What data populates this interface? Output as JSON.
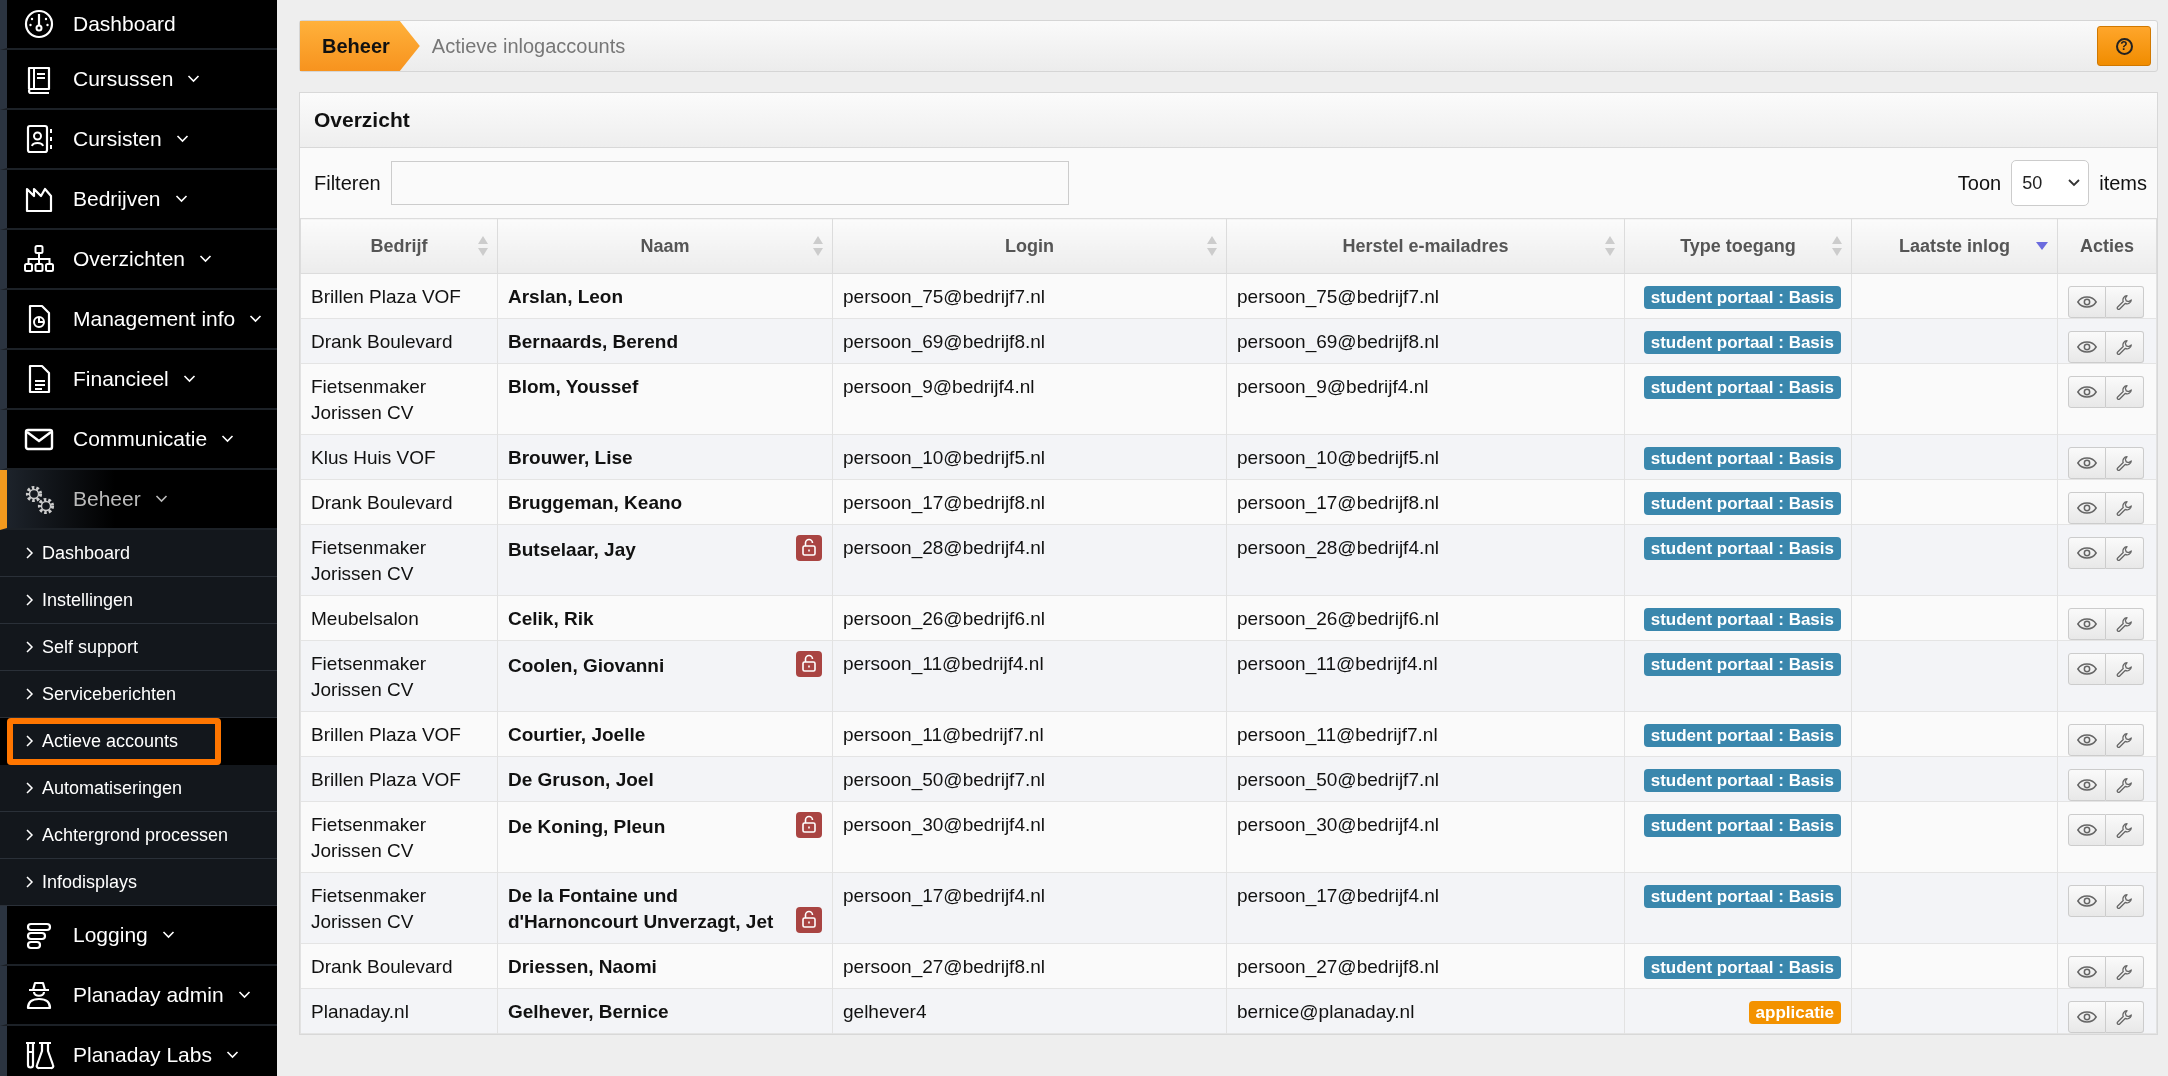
{
  "sidebar": {
    "items": [
      {
        "label": "Dashboard",
        "has_caret": false,
        "selected": false
      },
      {
        "label": "Cursussen",
        "has_caret": true,
        "selected": false
      },
      {
        "label": "Cursisten",
        "has_caret": true,
        "selected": false
      },
      {
        "label": "Bedrijven",
        "has_caret": true,
        "selected": false
      },
      {
        "label": "Overzichten",
        "has_caret": true,
        "selected": false
      },
      {
        "label": "Management info",
        "has_caret": true,
        "selected": false
      },
      {
        "label": "Financieel",
        "has_caret": true,
        "selected": false
      },
      {
        "label": "Communicatie",
        "has_caret": true,
        "selected": false
      },
      {
        "label": "Beheer",
        "has_caret": true,
        "selected": true,
        "children": [
          {
            "label": "Dashboard",
            "selected": false
          },
          {
            "label": "Instellingen",
            "selected": false
          },
          {
            "label": "Self support",
            "selected": false
          },
          {
            "label": "Serviceberichten",
            "selected": false
          },
          {
            "label": "Actieve accounts",
            "selected": true
          },
          {
            "label": "Automatiseringen",
            "selected": false
          },
          {
            "label": "Achtergrond processen",
            "selected": false
          },
          {
            "label": "Infodisplays",
            "selected": false
          }
        ]
      },
      {
        "label": "Logging",
        "has_caret": true,
        "selected": false
      },
      {
        "label": "Planaday admin",
        "has_caret": true,
        "selected": false
      },
      {
        "label": "Planaday Labs",
        "has_caret": true,
        "selected": false
      }
    ]
  },
  "breadcrumb": {
    "section": "Beheer",
    "page": "Actieve inlogaccounts",
    "help_button": "?"
  },
  "panel": {
    "title": "Overzicht",
    "filter_label": "Filteren",
    "show_label": "Toon",
    "page_size": "50",
    "items_label": "items"
  },
  "table": {
    "columns": [
      {
        "label": "Bedrijf",
        "sortable": true,
        "sorted": false
      },
      {
        "label": "Naam",
        "sortable": true,
        "sorted": false
      },
      {
        "label": "Login",
        "sortable": true,
        "sorted": false
      },
      {
        "label": "Herstel e-mailadres",
        "sortable": true,
        "sorted": false
      },
      {
        "label": "Type toegang",
        "sortable": true,
        "sorted": false
      },
      {
        "label": "Laatste inlog",
        "sortable": true,
        "sorted": true
      },
      {
        "label": "Acties",
        "sortable": false,
        "sorted": false
      }
    ],
    "rows": [
      {
        "company": "Brillen Plaza VOF",
        "name": "Arslan, Leon",
        "locked": false,
        "login": "persoon_75@bedrijf7.nl",
        "recovery_email": "persoon_75@bedrijf7.nl",
        "access": {
          "text": "student portaal : Basis",
          "color": "#3a87ad"
        }
      },
      {
        "company": "Drank Boulevard",
        "name": "Bernaards, Berend",
        "locked": false,
        "login": "persoon_69@bedrijf8.nl",
        "recovery_email": "persoon_69@bedrijf8.nl",
        "access": {
          "text": "student portaal : Basis",
          "color": "#3a87ad"
        }
      },
      {
        "company": "Fietsenmaker Jorissen CV",
        "name": "Blom, Youssef",
        "locked": false,
        "login": "persoon_9@bedrijf4.nl",
        "recovery_email": "persoon_9@bedrijf4.nl",
        "access": {
          "text": "student portaal : Basis",
          "color": "#3a87ad"
        }
      },
      {
        "company": "Klus Huis VOF",
        "name": "Brouwer, Lise",
        "locked": false,
        "login": "persoon_10@bedrijf5.nl",
        "recovery_email": "persoon_10@bedrijf5.nl",
        "access": {
          "text": "student portaal : Basis",
          "color": "#3a87ad"
        }
      },
      {
        "company": "Drank Boulevard",
        "name": "Bruggeman, Keano",
        "locked": false,
        "login": "persoon_17@bedrijf8.nl",
        "recovery_email": "persoon_17@bedrijf8.nl",
        "access": {
          "text": "student portaal : Basis",
          "color": "#3a87ad"
        }
      },
      {
        "company": "Fietsenmaker Jorissen CV",
        "name": "Butselaar, Jay",
        "locked": true,
        "login": "persoon_28@bedrijf4.nl",
        "recovery_email": "persoon_28@bedrijf4.nl",
        "access": {
          "text": "student portaal : Basis",
          "color": "#3a87ad"
        }
      },
      {
        "company": "Meubelsalon",
        "name": "Celik, Rik",
        "locked": false,
        "login": "persoon_26@bedrijf6.nl",
        "recovery_email": "persoon_26@bedrijf6.nl",
        "access": {
          "text": "student portaal : Basis",
          "color": "#3a87ad"
        }
      },
      {
        "company": "Fietsenmaker Jorissen CV",
        "name": "Coolen, Giovanni",
        "locked": true,
        "login": "persoon_11@bedrijf4.nl",
        "recovery_email": "persoon_11@bedrijf4.nl",
        "access": {
          "text": "student portaal : Basis",
          "color": "#3a87ad"
        }
      },
      {
        "company": "Brillen Plaza VOF",
        "name": "Courtier, Joelle",
        "locked": false,
        "login": "persoon_11@bedrijf7.nl",
        "recovery_email": "persoon_11@bedrijf7.nl",
        "access": {
          "text": "student portaal : Basis",
          "color": "#3a87ad"
        }
      },
      {
        "company": "Brillen Plaza VOF",
        "name": "De Gruson, Joel",
        "locked": false,
        "login": "persoon_50@bedrijf7.nl",
        "recovery_email": "persoon_50@bedrijf7.nl",
        "access": {
          "text": "student portaal : Basis",
          "color": "#3a87ad"
        }
      },
      {
        "company": "Fietsenmaker Jorissen CV",
        "name": "De Koning, Pleun",
        "locked": true,
        "login": "persoon_30@bedrijf4.nl",
        "recovery_email": "persoon_30@bedrijf4.nl",
        "access": {
          "text": "student portaal : Basis",
          "color": "#3a87ad"
        }
      },
      {
        "company": "Fietsenmaker Jorissen CV",
        "name": "De la Fontaine und d'Harnoncourt Unverzagt, Jet",
        "locked": true,
        "login": "persoon_17@bedrijf4.nl",
        "recovery_email": "persoon_17@bedrijf4.nl",
        "access": {
          "text": "student portaal : Basis",
          "color": "#3a87ad"
        }
      },
      {
        "company": "Drank Boulevard",
        "name": "Driessen, Naomi",
        "locked": false,
        "login": "persoon_27@bedrijf8.nl",
        "recovery_email": "persoon_27@bedrijf8.nl",
        "access": {
          "text": "student portaal : Basis",
          "color": "#3a87ad"
        }
      },
      {
        "company": "Planaday.nl",
        "name": "Gelhever, Bernice",
        "locked": false,
        "login": "gelhever4",
        "recovery_email": "bernice@planaday.nl",
        "access": {
          "text": "applicatie",
          "color": "#f39200"
        }
      }
    ]
  }
}
